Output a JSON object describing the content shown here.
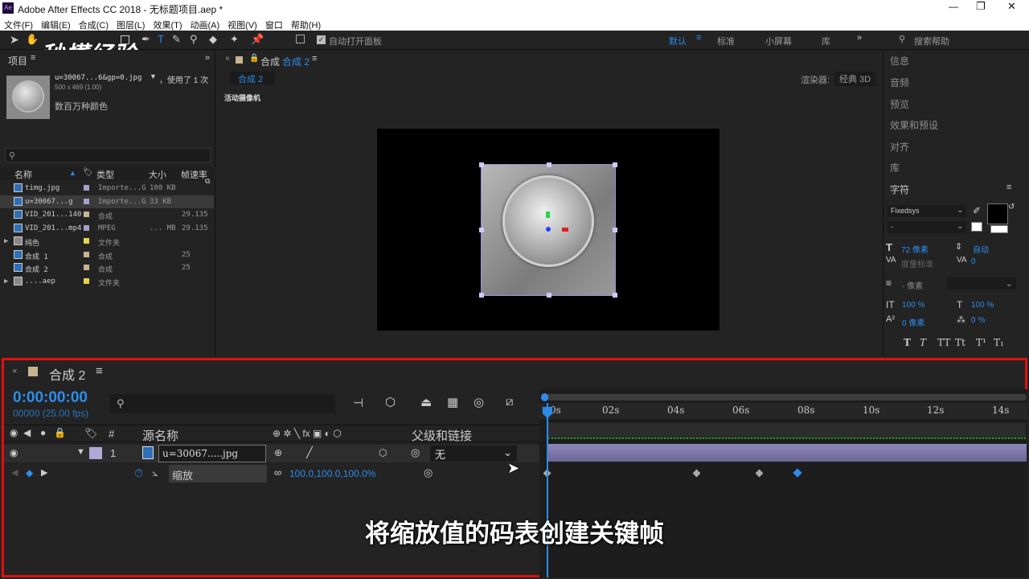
{
  "app": {
    "icon": "Ae",
    "title": "Adobe After Effects CC 2018 - 无标题项目.aep *"
  },
  "menu": [
    "文件(F)",
    "编辑(E)",
    "合成(C)",
    "图层(L)",
    "效果(T)",
    "动画(A)",
    "视图(V)",
    "窗口",
    "帮助(H)"
  ],
  "toolbar": {
    "auto_open": "自动打开面板",
    "workspaces": [
      "默认",
      "标准",
      "小屏幕",
      "库"
    ],
    "search_placeholder": "搜索帮助",
    "watermark": "秒懂经验"
  },
  "project": {
    "title": "项目",
    "file_name": "u=30067...6&gp=0.jpg",
    "used": "，使用了 1 次",
    "dims": "500 x 469 (1.00)",
    "colors": "数百万种颜色",
    "headers": [
      "名称",
      "类型",
      "大小",
      "帧速率"
    ],
    "items": [
      {
        "name": "timg.jpg",
        "type": "Importe...G",
        "size": "100 KB",
        "fps": "",
        "color": "#a89fc6",
        "icon": "image-icon"
      },
      {
        "name": "u=30067...g",
        "type": "Importe...G",
        "size": "33 KB",
        "fps": "",
        "color": "#a89fc6",
        "icon": "image-icon"
      },
      {
        "name": "VID_201...140",
        "type": "合成",
        "size": "",
        "fps": "29.135",
        "color": "#c8b490",
        "icon": "composition-icon"
      },
      {
        "name": "VID_201...mp4",
        "type": "MPEG",
        "size": "... MB",
        "fps": "29.135",
        "color": "#a89fc6",
        "icon": "video-icon"
      },
      {
        "name": "纯色",
        "type": "文件夹",
        "size": "",
        "fps": "",
        "color": "#e6d44a",
        "icon": "folder-icon"
      },
      {
        "name": "合成 1",
        "type": "合成",
        "size": "",
        "fps": "25",
        "color": "#c8b490",
        "icon": "composition-icon"
      },
      {
        "name": "合成 2",
        "type": "合成",
        "size": "",
        "fps": "25",
        "color": "#c8b490",
        "icon": "composition-icon"
      },
      {
        "name": "....aep",
        "type": "文件夹",
        "size": "",
        "fps": "",
        "color": "#e6d44a",
        "icon": "folder-icon"
      }
    ]
  },
  "comp": {
    "panel_label": "合成",
    "panel_name": "合成 2",
    "tab": "合成 2",
    "renderer_label": "渲染器:",
    "renderer": "经典 3D",
    "camera": "活动摄像机"
  },
  "right": {
    "items": [
      "信息",
      "音频",
      "预览",
      "效果和预设",
      "对齐",
      "库"
    ],
    "char_title": "字符",
    "font": "Fixedsys",
    "style": "-",
    "size": "72 像素",
    "leading": "自动",
    "kerning": "度量标准",
    "tracking": "0",
    "stroke": "- 像素",
    "vscale": "100 %",
    "hscale": "100 %",
    "baseline": "0 像素",
    "tsume": "0 %",
    "styles": [
      "T",
      "T",
      "TT",
      "Tt",
      "T¹",
      "T₁"
    ]
  },
  "timeline": {
    "comp_name": "合成 2",
    "timecode": "0:00:00:00",
    "fps": "00000 (25.00 fps)",
    "col_source": "源名称",
    "col_parent": "父级和链接",
    "layer_num": "1",
    "layer_name": "u=30067.....jpg",
    "parent": "无",
    "prop_name": "缩放",
    "prop_value": "100.0,100.0,100.0%",
    "ruler": [
      "0s",
      "02s",
      "04s",
      "06s",
      "08s",
      "10s",
      "12s",
      "14s"
    ]
  },
  "caption": "将缩放值的码表创建关键帧"
}
